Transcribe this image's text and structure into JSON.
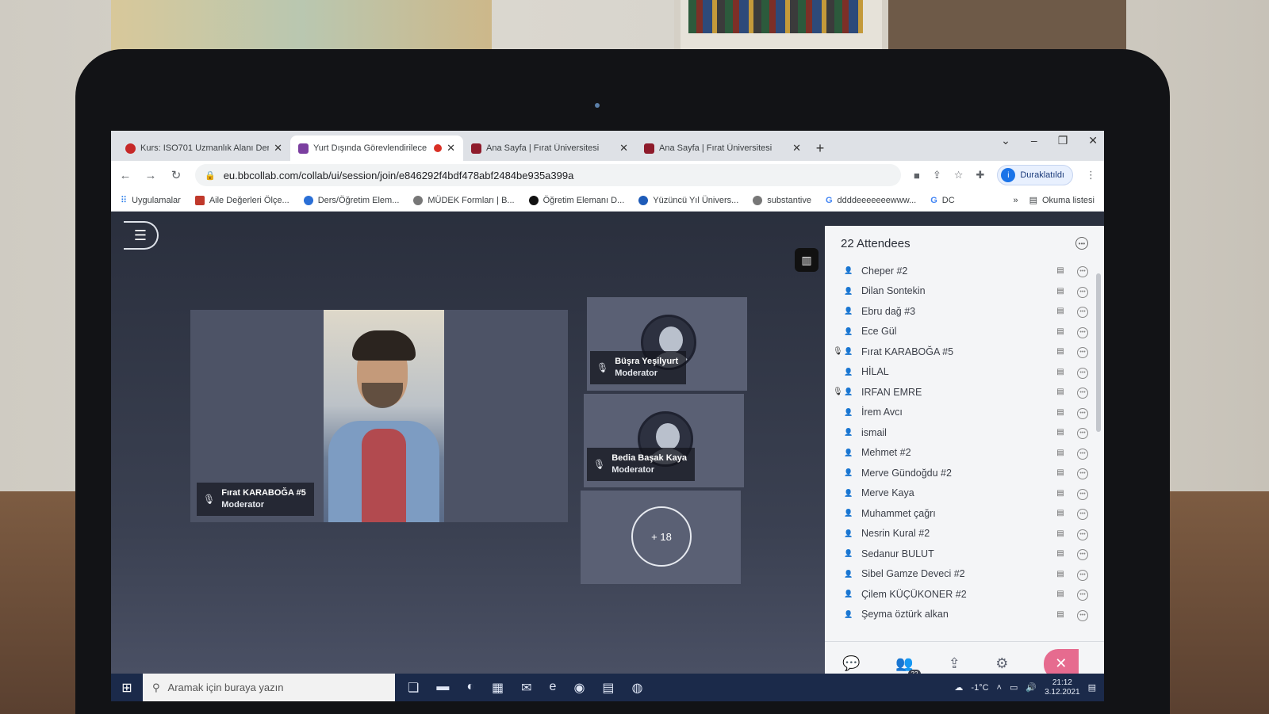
{
  "browser": {
    "tabs": [
      {
        "label": "Kurs: ISO701 Uzmanlık Alanı Der:",
        "favicon": "red-circle-icon"
      },
      {
        "label": "Yurt Dışında Görevlendirilece",
        "favicon": "purple-play-icon",
        "active": true
      },
      {
        "label": "Ana Sayfa | Fırat Üniversitesi",
        "favicon": "university-icon"
      },
      {
        "label": "Ana Sayfa | Fırat Üniversitesi",
        "favicon": "university-icon"
      }
    ],
    "url": "eu.bbcollab.com/collab/ui/session/join/e846292f4bdf478abf2484be935a399a",
    "profile_label": "Duraklatıldı",
    "profile_initial": "i",
    "bookmarks": [
      "Uygulamalar",
      "Aile Değerleri Ölçe...",
      "Ders/Öğretim Elem...",
      "MÜDEK Formları | B...",
      "Öğretim Elemanı D...",
      "Yüzüncü Yıl Ünivers...",
      "substantive",
      "ddddeeeeeeewww...",
      "DC"
    ],
    "bookmarks_overflow": "»",
    "reading_list": "Okuma listesi"
  },
  "session": {
    "main_speaker": {
      "name": "Fırat KARABOĞA #5",
      "role": "Moderator"
    },
    "tiles": [
      {
        "name": "Büşra Yeşilyurt",
        "role": "Moderator"
      },
      {
        "name": "Bedia Başak Kaya",
        "role": "Moderator"
      }
    ],
    "overflow_count": "+ 18"
  },
  "attendees": {
    "header": "22 Attendees",
    "badge_count": "22",
    "items": [
      {
        "name": "Cheper #2",
        "speaking": false
      },
      {
        "name": "Dilan Sontekin",
        "speaking": false
      },
      {
        "name": "Ebru dağ #3",
        "speaking": false
      },
      {
        "name": "Ece Gül",
        "speaking": false
      },
      {
        "name": "Fırat KARABOĞA #5",
        "speaking": true
      },
      {
        "name": "HİLAL",
        "speaking": false
      },
      {
        "name": "IRFAN EMRE",
        "speaking": true
      },
      {
        "name": "İrem Avcı",
        "speaking": false
      },
      {
        "name": "ismail",
        "speaking": false
      },
      {
        "name": "Mehmet #2",
        "speaking": false
      },
      {
        "name": "Merve Gündoğdu #2",
        "speaking": false
      },
      {
        "name": "Merve Kaya",
        "speaking": false
      },
      {
        "name": "Muhammet çağrı",
        "speaking": false
      },
      {
        "name": "Nesrin Kural #2",
        "speaking": false
      },
      {
        "name": "Sedanur BULUT",
        "speaking": false
      },
      {
        "name": "Sibel Gamze Deveci #2",
        "speaking": false
      },
      {
        "name": "Çilem KÜÇÜKONER #2",
        "speaking": false
      },
      {
        "name": "Şeyma öztürk alkan",
        "speaking": false
      }
    ]
  },
  "taskbar": {
    "search_placeholder": "Aramak için buraya yazın",
    "temperature": "-1°C",
    "time": "21:12",
    "date": "3.12.2021"
  },
  "colors": {
    "collab_bg": "#2a2f3d",
    "camera_active": "#1e6fb5",
    "leave_button": "#e66b8f",
    "taskbar": "#1b2a4a"
  }
}
